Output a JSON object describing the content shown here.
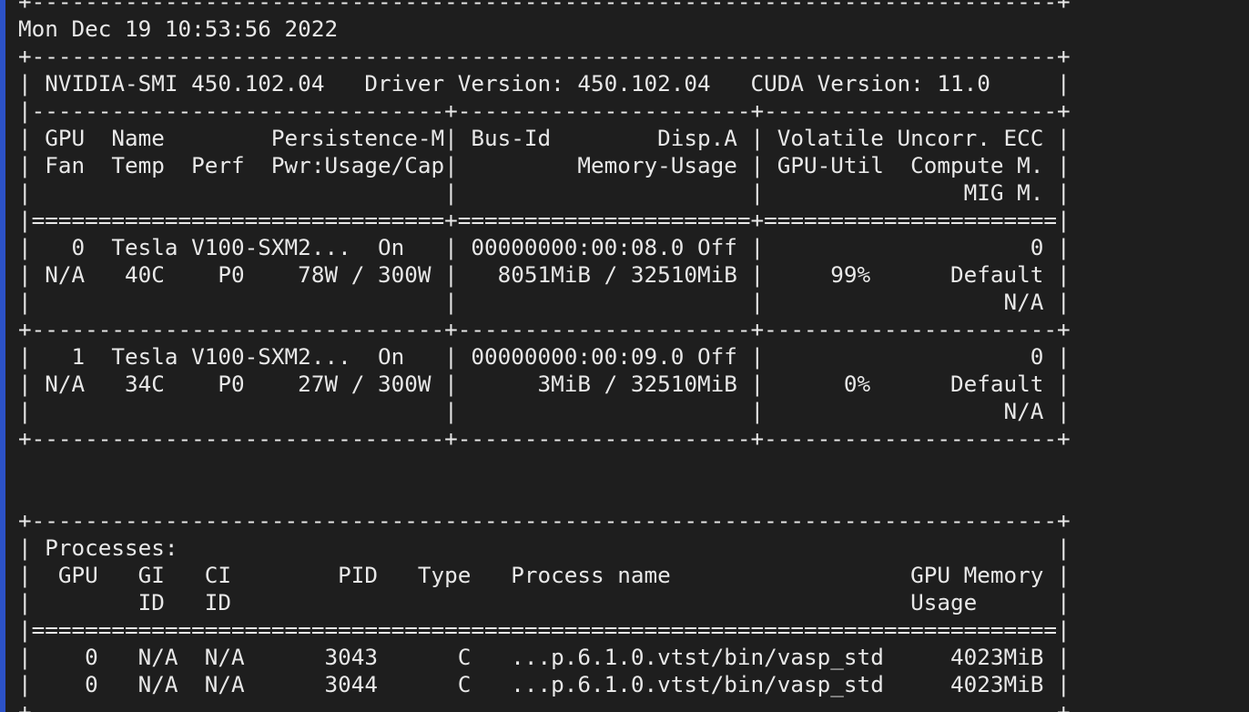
{
  "colors": {
    "background": "#1e1e1e",
    "text": "#e8e8e8",
    "accent": "#2c52c7"
  },
  "terminal": {
    "lines": [
      "+-----------------------------------------------------------------------------+",
      "Mon Dec 19 10:53:56 2022",
      "+-----------------------------------------------------------------------------+",
      "| NVIDIA-SMI 450.102.04   Driver Version: 450.102.04   CUDA Version: 11.0     |",
      "|-------------------------------+----------------------+----------------------+",
      "| GPU  Name        Persistence-M| Bus-Id        Disp.A | Volatile Uncorr. ECC |",
      "| Fan  Temp  Perf  Pwr:Usage/Cap|         Memory-Usage | GPU-Util  Compute M. |",
      "|                               |                      |               MIG M. |",
      "|===============================+======================+======================|",
      "|   0  Tesla V100-SXM2...  On   | 00000000:00:08.0 Off |                    0 |",
      "| N/A   40C    P0    78W / 300W |   8051MiB / 32510MiB |     99%      Default |",
      "|                               |                      |                  N/A |",
      "+-------------------------------+----------------------+----------------------+",
      "|   1  Tesla V100-SXM2...  On   | 00000000:00:09.0 Off |                    0 |",
      "| N/A   34C    P0    27W / 300W |      3MiB / 32510MiB |      0%      Default |",
      "|                               |                      |                  N/A |",
      "+-------------------------------+----------------------+----------------------+",
      "",
      "",
      "+-----------------------------------------------------------------------------+",
      "| Processes:                                                                  |",
      "|  GPU   GI   CI        PID   Type   Process name                  GPU Memory |",
      "|        ID   ID                                                   Usage      |",
      "|=============================================================================|",
      "|    0   N/A  N/A      3043      C   ...p.6.1.0.vtst/bin/vasp_std     4023MiB |",
      "|    0   N/A  N/A      3044      C   ...p.6.1.0.vtst/bin/vasp_std     4023MiB |",
      "+-----------------------------------------------------------------------------+"
    ]
  }
}
